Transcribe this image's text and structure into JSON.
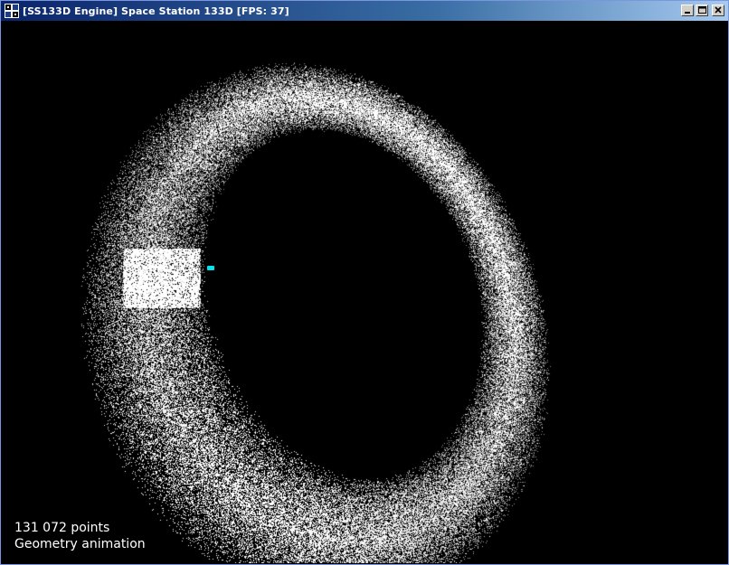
{
  "window": {
    "title": "[SS133D Engine] Space Station 133D [FPS: 37]",
    "icon": "app-icon",
    "controls": {
      "minimize_icon": "minimize-icon",
      "maximize_icon": "maximize-icon",
      "close_icon": "close-icon"
    },
    "title_colors": {
      "start": "#0a246a",
      "end": "#a6caf0"
    }
  },
  "viewport": {
    "background": "#000000",
    "point_color": "#ffffff",
    "marker_color": "#00e5ee",
    "overlay": {
      "point_count": "131 072 points",
      "mode": "Geometry animation"
    }
  }
}
